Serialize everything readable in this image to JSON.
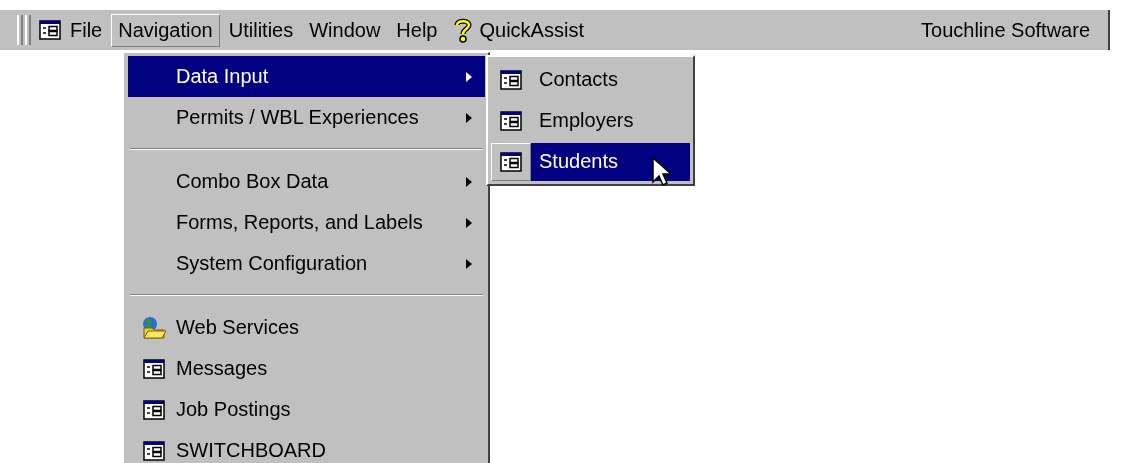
{
  "menubar": {
    "items": [
      {
        "label": "File",
        "kind": "text",
        "selected": false
      },
      {
        "label": "Navigation",
        "kind": "text",
        "selected": true
      },
      {
        "label": "Utilities",
        "kind": "text",
        "selected": false
      },
      {
        "label": "Window",
        "kind": "text",
        "selected": false
      },
      {
        "label": "Help",
        "kind": "text",
        "selected": false
      },
      {
        "label": "QuickAssist",
        "kind": "help",
        "selected": false
      }
    ],
    "brand": "Touchline Software"
  },
  "menu": {
    "items": [
      {
        "kind": "submenu",
        "label": "Data Input",
        "selected": true
      },
      {
        "kind": "submenu",
        "label": "Permits / WBL Experiences",
        "selected": false
      },
      {
        "kind": "separator"
      },
      {
        "kind": "submenu",
        "label": "Combo Box Data",
        "selected": false
      },
      {
        "kind": "submenu",
        "label": "Forms, Reports, and Labels",
        "selected": false
      },
      {
        "kind": "submenu",
        "label": "System Configuration",
        "selected": false
      },
      {
        "kind": "separator"
      },
      {
        "kind": "web",
        "label": "Web Services",
        "selected": false
      },
      {
        "kind": "form",
        "label": "Messages",
        "selected": false
      },
      {
        "kind": "form",
        "label": "Job Postings",
        "selected": false
      },
      {
        "kind": "form",
        "label": "SWITCHBOARD",
        "selected": false
      }
    ]
  },
  "submenu": {
    "items": [
      {
        "label": "Contacts",
        "selected": false
      },
      {
        "label": "Employers",
        "selected": false
      },
      {
        "label": "Students",
        "selected": true
      }
    ]
  }
}
